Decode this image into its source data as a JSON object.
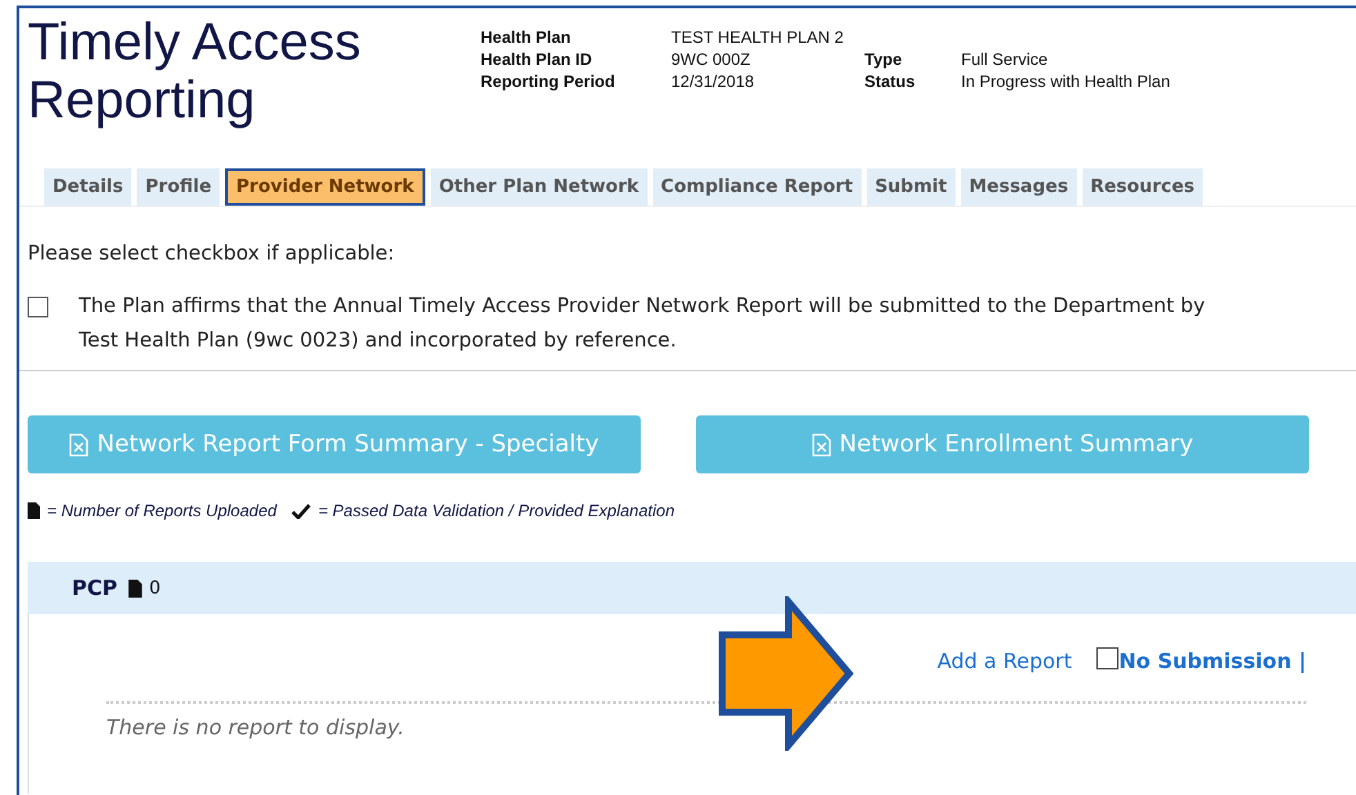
{
  "title": "Timely Access Reporting",
  "info": [
    {
      "label": "Health Plan",
      "value": "TEST HEALTH PLAN 2"
    },
    {
      "label": "Health Plan ID",
      "value": "9WC 000Z",
      "label2": "Type",
      "value2": "Full Service"
    },
    {
      "label": "Reporting Period",
      "value": "12/31/2018",
      "label2": "Status",
      "value2": "In Progress with Health Plan"
    }
  ],
  "tabs": [
    {
      "label": "Details",
      "selected": false
    },
    {
      "label": "Profile",
      "selected": false
    },
    {
      "label": "Provider Network",
      "selected": true
    },
    {
      "label": "Other Plan Network",
      "selected": false
    },
    {
      "label": "Compliance Report",
      "selected": false
    },
    {
      "label": "Submit",
      "selected": false
    },
    {
      "label": "Messages",
      "selected": false
    },
    {
      "label": "Resources",
      "selected": false
    }
  ],
  "instruction": "Please select checkbox if applicable:",
  "affirm": {
    "checked": false,
    "text": "The Plan affirms that the Annual Timely Access Provider Network Report will be submitted to the Department by Test Health Plan (9wc 0023) and incorporated by reference."
  },
  "buttons": [
    "Network Report Form Summary - Specialty",
    "Network Enrollment Summary"
  ],
  "legend": {
    "reports": "= Number of Reports Uploaded",
    "passed": "= Passed Data Validation / Provided Explanation"
  },
  "section": {
    "title": "PCP",
    "count": "0",
    "add_link": "Add a Report",
    "no_submission": {
      "label": "No Submission |",
      "checked": false
    },
    "empty": "There is no report to display."
  }
}
